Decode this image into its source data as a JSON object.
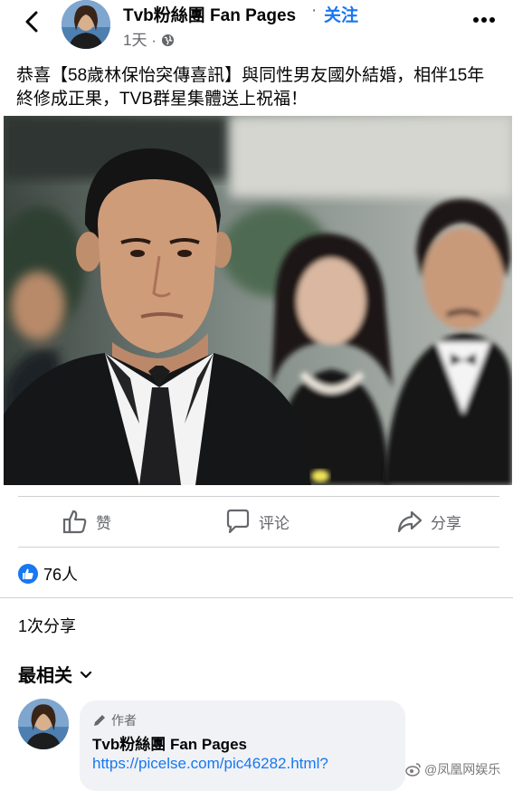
{
  "header": {
    "page_name": "Tvb粉絲團 Fan Pages",
    "separator": "·",
    "follow_label": "关注",
    "time": "1天",
    "time_separator": "·"
  },
  "post": {
    "text": "恭喜【58歲林保怡突傳喜訊】與同性男友國外結婚，相伴15年終修成正果，TVB群星集體送上祝福！"
  },
  "actions": {
    "like": "赞",
    "comment": "评论",
    "share": "分享"
  },
  "stats": {
    "reaction_count": "76人",
    "share_count": "1次分享"
  },
  "comments": {
    "sort_label": "最相关",
    "items": [
      {
        "tag": "作者",
        "name": "Tvb粉絲團 Fan Pages",
        "link": "https://picelse.com/pic46282.html?"
      }
    ]
  },
  "watermark": "@凤凰网娱乐",
  "icons": {
    "back": "chevron-left-icon",
    "globe": "globe-icon",
    "more": "more-horizontal-icon",
    "like": "thumbs-up-icon",
    "comment": "speech-bubble-icon",
    "share": "share-arrow-icon",
    "sort": "chevron-down-icon",
    "author": "pencil-icon"
  },
  "colors": {
    "brand": "#1877f2",
    "secondary_text": "#65676b",
    "divider": "#ced0d4",
    "bubble": "#f0f2f5"
  }
}
